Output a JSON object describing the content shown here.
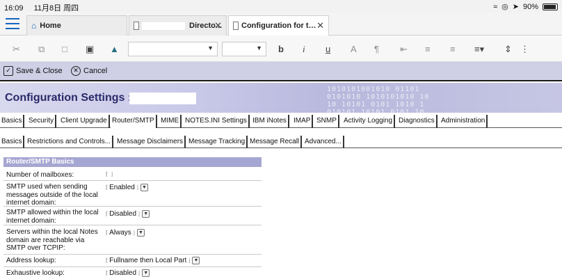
{
  "status_bar": {
    "time": "16:09",
    "date": "11月8日 周四",
    "battery": "90%"
  },
  "tabs": {
    "home": "Home",
    "directory": "Directo...",
    "config": "Configuration for t…"
  },
  "actions": {
    "save_close": "Save & Close",
    "cancel": "Cancel"
  },
  "banner": {
    "title": "Configuration Settings :",
    "digits": "1010101001010 01101\n0101010 1010101010 10\n10 10101 0101 1010 1\n010101 10101 0101 10"
  },
  "main_tabs": [
    "Basics",
    "Security",
    "Client Upgrade",
    "Router/SMTP",
    "MIME",
    "NOTES.INI Settings",
    "IBM iNotes",
    "IMAP",
    "SNMP",
    "Activity Logging",
    "Diagnostics",
    "Administration"
  ],
  "sub_tabs": [
    "Basics",
    "Restrictions and Controls...",
    "Message Disclaimers",
    "Message Tracking",
    "Message Recall",
    "Advanced..."
  ],
  "section": {
    "header": "Router/SMTP Basics"
  },
  "fields": [
    {
      "label": "Number of mailboxes:",
      "value": ""
    },
    {
      "label": "SMTP used when sending messages outside of the local internet domain:",
      "value": "Enabled"
    },
    {
      "label": "SMTP allowed within the local internet domain:",
      "value": "Disabled"
    },
    {
      "label": "Servers within the local Notes domain are reachable via SMTP over TCPIP:",
      "value": "Always"
    },
    {
      "label": "Address lookup:",
      "value": "Fullname then Local Part"
    },
    {
      "label": "Exhaustive lookup:",
      "value": "Disabled"
    }
  ]
}
